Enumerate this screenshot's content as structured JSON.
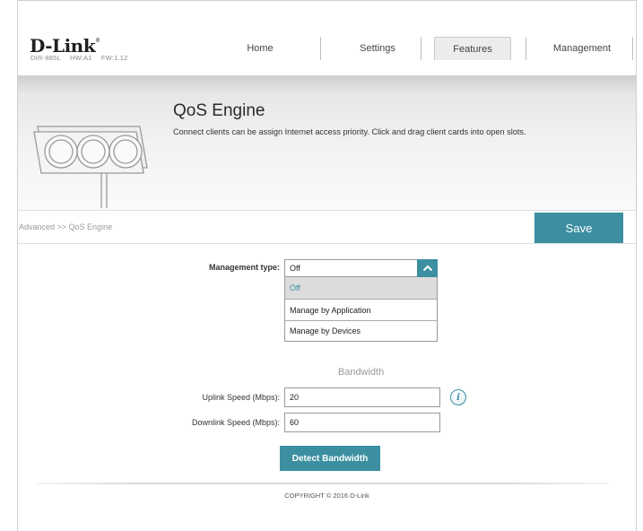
{
  "header": {
    "logo": "D-Link",
    "model": "DIR-885L",
    "hw": "HW:A1",
    "fw": "FW:1.12",
    "nav": [
      "Home",
      "Settings",
      "Features",
      "Management"
    ],
    "active_nav": "Features"
  },
  "banner": {
    "title": "QoS Engine",
    "description": "Connect clients can be assign Internet access priority. Click and drag client cards into open slots."
  },
  "breadcrumb": "Advanced >> QoS Engine",
  "save_label": "Save",
  "form": {
    "management_type_label": "Management type:",
    "management_type_value": "Off",
    "options": [
      "Off",
      "Manage by Application",
      "Manage by Devices"
    ],
    "bandwidth_title": "Bandwidth",
    "uplink_label": "Uplink Speed (Mbps):",
    "uplink_value": "20",
    "downlink_label": "Downlink Speed (Mbps):",
    "downlink_value": "60",
    "detect_label": "Detect Bandwidth"
  },
  "footer": "COPYRIGHT © 2016 D-Link",
  "colors": {
    "accent": "#3b8fa0"
  }
}
